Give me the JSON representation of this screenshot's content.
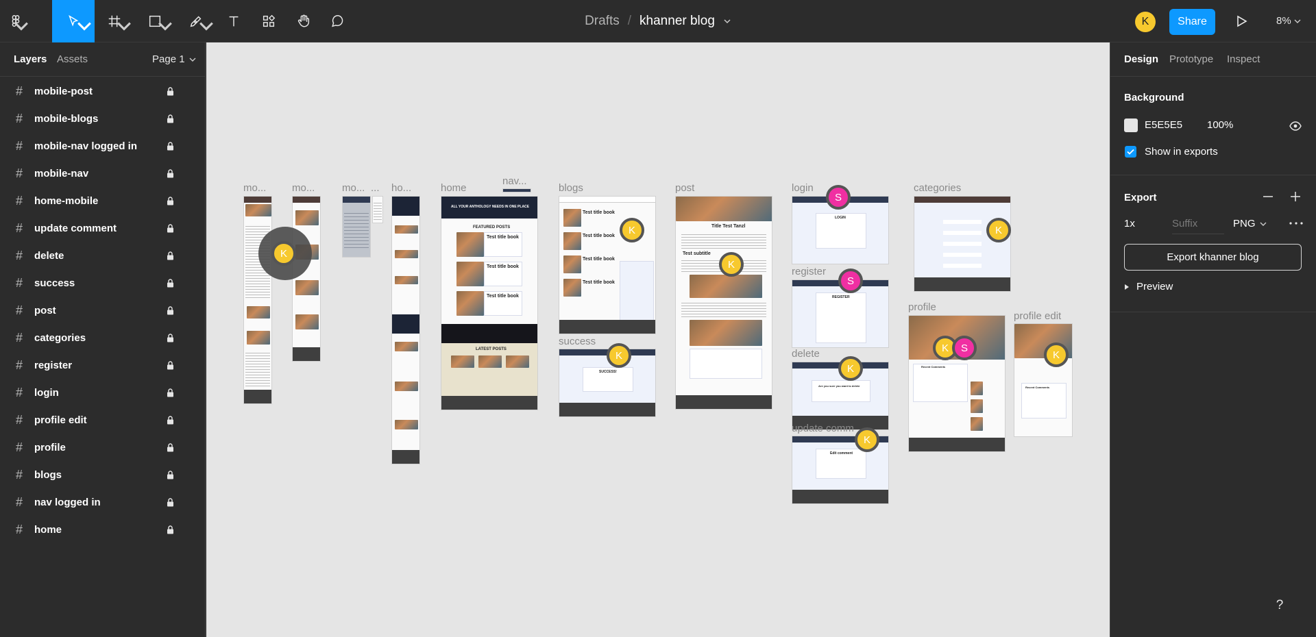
{
  "toolbar": {
    "tools": [
      "figma-menu-icon",
      "move-tool-icon",
      "frame-tool-icon",
      "shape-tool-icon",
      "pen-tool-icon",
      "text-tool-icon",
      "resources-icon",
      "hand-tool-icon",
      "comment-icon"
    ],
    "breadcrumb_parent": "Drafts",
    "breadcrumb_separator": "/",
    "file_name": "khanner blog",
    "avatar_letter": "K",
    "share_label": "Share",
    "zoom": "8%"
  },
  "left_panel": {
    "tab_layers": "Layers",
    "tab_assets": "Assets",
    "page": "Page 1",
    "layers": [
      {
        "name": "mobile-post"
      },
      {
        "name": "mobile-blogs"
      },
      {
        "name": "mobile-nav logged in"
      },
      {
        "name": "mobile-nav"
      },
      {
        "name": "home-mobile"
      },
      {
        "name": "update comment"
      },
      {
        "name": "delete"
      },
      {
        "name": "success"
      },
      {
        "name": "post"
      },
      {
        "name": "categories"
      },
      {
        "name": "register"
      },
      {
        "name": "login"
      },
      {
        "name": "profile edit"
      },
      {
        "name": "profile"
      },
      {
        "name": "blogs"
      },
      {
        "name": "nav logged in"
      },
      {
        "name": "home"
      }
    ]
  },
  "canvas": {
    "background": "#E5E5E5",
    "frame_labels": {
      "mo1": "mo...",
      "mo2": "mo...",
      "mo3": "mo...",
      "dots": "...",
      "ho": "ho...",
      "home": "home",
      "nav": "nav...",
      "blogs": "blogs",
      "post": "post",
      "login": "login",
      "categories": "categories",
      "success": "success",
      "register": "register",
      "delete": "delete",
      "profile": "profile",
      "profile_edit": "profile edit",
      "update_comment": "update comm"
    },
    "frame_text": {
      "home_hero": "ALL YOUR ANTHOLOGY NEEDS IN ONE PLACE",
      "featured_posts": "FEATURED POSTS",
      "latest_posts": "LATEST POSTS",
      "test_title_book": "Test title book",
      "post_title": "Title Test Tanzl",
      "post_subtitle": "Test subtitle",
      "login_title": "LOGIN",
      "register_title": "REGISTER",
      "success_title": "SUCCESS!",
      "delete_question": "Are you sure you want to delete",
      "edit_comment": "Edit comment",
      "recent_comments": "Recent Comments",
      "title_text": "Title Test Tanzl"
    },
    "cursors": {
      "k": "K",
      "s": "S"
    }
  },
  "right_panel": {
    "tabs": [
      "Design",
      "Prototype",
      "Inspect"
    ],
    "background_title": "Background",
    "bg_hex": "E5E5E5",
    "bg_opacity": "100%",
    "show_in_exports": "Show in exports",
    "export_title": "Export",
    "export_scale": "1x",
    "export_suffix_placeholder": "Suffix",
    "export_format": "PNG",
    "export_button": "Export khanner blog",
    "preview": "Preview"
  },
  "help": "?"
}
